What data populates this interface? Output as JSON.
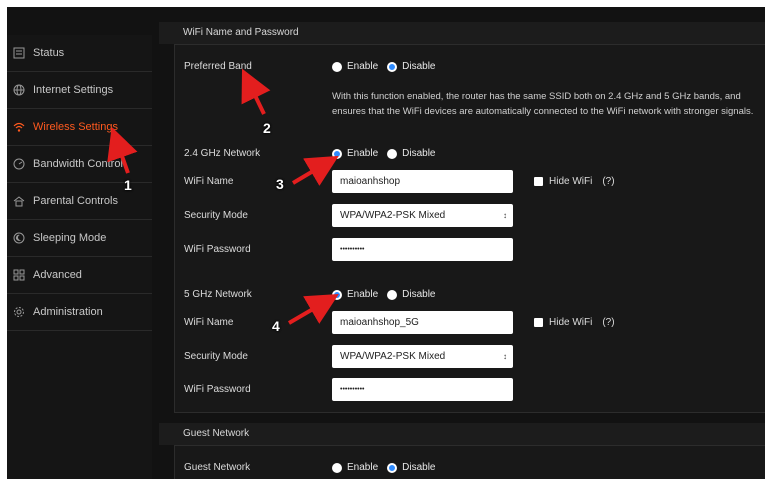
{
  "sidebar": {
    "items": [
      {
        "label": "Status",
        "icon": "status-icon"
      },
      {
        "label": "Internet Settings",
        "icon": "globe-icon"
      },
      {
        "label": "Wireless Settings",
        "icon": "wifi-icon",
        "active": true
      },
      {
        "label": "Bandwidth Control",
        "icon": "bandwidth-icon"
      },
      {
        "label": "Parental Controls",
        "icon": "parental-icon"
      },
      {
        "label": "Sleeping Mode",
        "icon": "sleep-icon"
      },
      {
        "label": "Advanced",
        "icon": "grid-icon"
      },
      {
        "label": "Administration",
        "icon": "gear-icon"
      }
    ]
  },
  "wifi_section": {
    "title": "WiFi Name and Password",
    "preferred_band": {
      "label": "Preferred Band",
      "enable_label": "Enable",
      "disable_label": "Disable",
      "selected": "Disable",
      "info": "With this function enabled, the router has the same SSID both on 2.4 GHz and 5 GHz bands, and ensures that the WiFi devices are automatically connected to the WiFi network with stronger signals."
    },
    "band_24": {
      "label": "2.4 GHz Network",
      "enable_label": "Enable",
      "disable_label": "Disable",
      "selected": "Enable",
      "wifi_name_label": "WiFi Name",
      "wifi_name": "maioanhshop",
      "hide_wifi_label": "Hide WiFi",
      "hide_wifi_help": "(?)",
      "security_label": "Security Mode",
      "security_value": "WPA/WPA2-PSK Mixed",
      "password_label": "WiFi Password",
      "password_value": "••••••••••"
    },
    "band_5": {
      "label": "5 GHz Network",
      "enable_label": "Enable",
      "disable_label": "Disable",
      "selected": "Enable",
      "wifi_name_label": "WiFi Name",
      "wifi_name": "maioanhshop_5G",
      "hide_wifi_label": "Hide WiFi",
      "hide_wifi_help": "(?)",
      "security_label": "Security Mode",
      "security_value": "WPA/WPA2-PSK Mixed",
      "password_label": "WiFi Password",
      "password_value": "••••••••••"
    }
  },
  "guest_section": {
    "title": "Guest Network",
    "label": "Guest Network",
    "enable_label": "Enable",
    "disable_label": "Disable",
    "selected": "Disable"
  },
  "annotations": [
    "1",
    "2",
    "3",
    "4"
  ],
  "colors": {
    "accent": "#ff5a1f",
    "radio_selected": "#2e8bff",
    "arrow": "#e31e1e"
  }
}
